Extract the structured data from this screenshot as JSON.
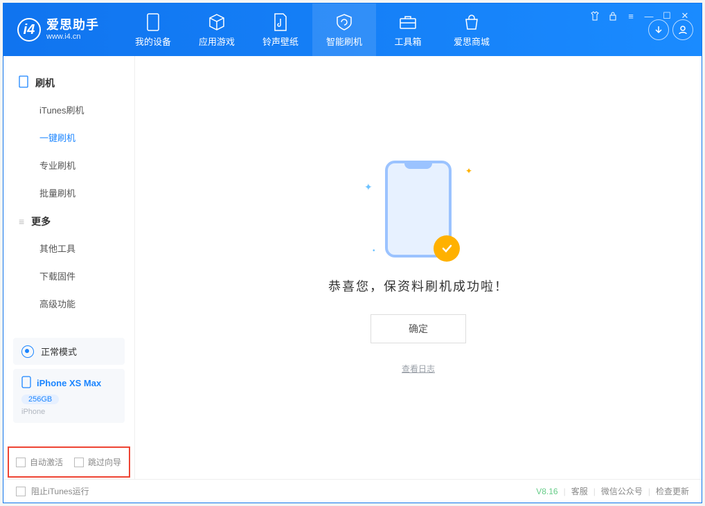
{
  "logo": {
    "title": "爱思助手",
    "sub": "www.i4.cn"
  },
  "nav": {
    "device": "我的设备",
    "apps": "应用游戏",
    "rings": "铃声壁纸",
    "flash": "智能刷机",
    "tools": "工具箱",
    "store": "爱思商城"
  },
  "sidebar": {
    "group_flash": "刷机",
    "items_flash": {
      "itunes": "iTunes刷机",
      "onekey": "一键刷机",
      "pro": "专业刷机",
      "batch": "批量刷机"
    },
    "group_more": "更多",
    "items_more": {
      "other": "其他工具",
      "firmware": "下载固件",
      "advanced": "高级功能"
    },
    "mode_label": "正常模式",
    "device_name": "iPhone XS Max",
    "device_storage": "256GB",
    "device_type": "iPhone",
    "chk_activate": "自动激活",
    "chk_skip": "跳过向导"
  },
  "main": {
    "message": "恭喜您，保资料刷机成功啦！",
    "ok": "确定",
    "log_link": "查看日志"
  },
  "status": {
    "stop_itunes": "阻止iTunes运行",
    "version": "V8.16",
    "support": "客服",
    "wechat": "微信公众号",
    "update": "检查更新"
  }
}
